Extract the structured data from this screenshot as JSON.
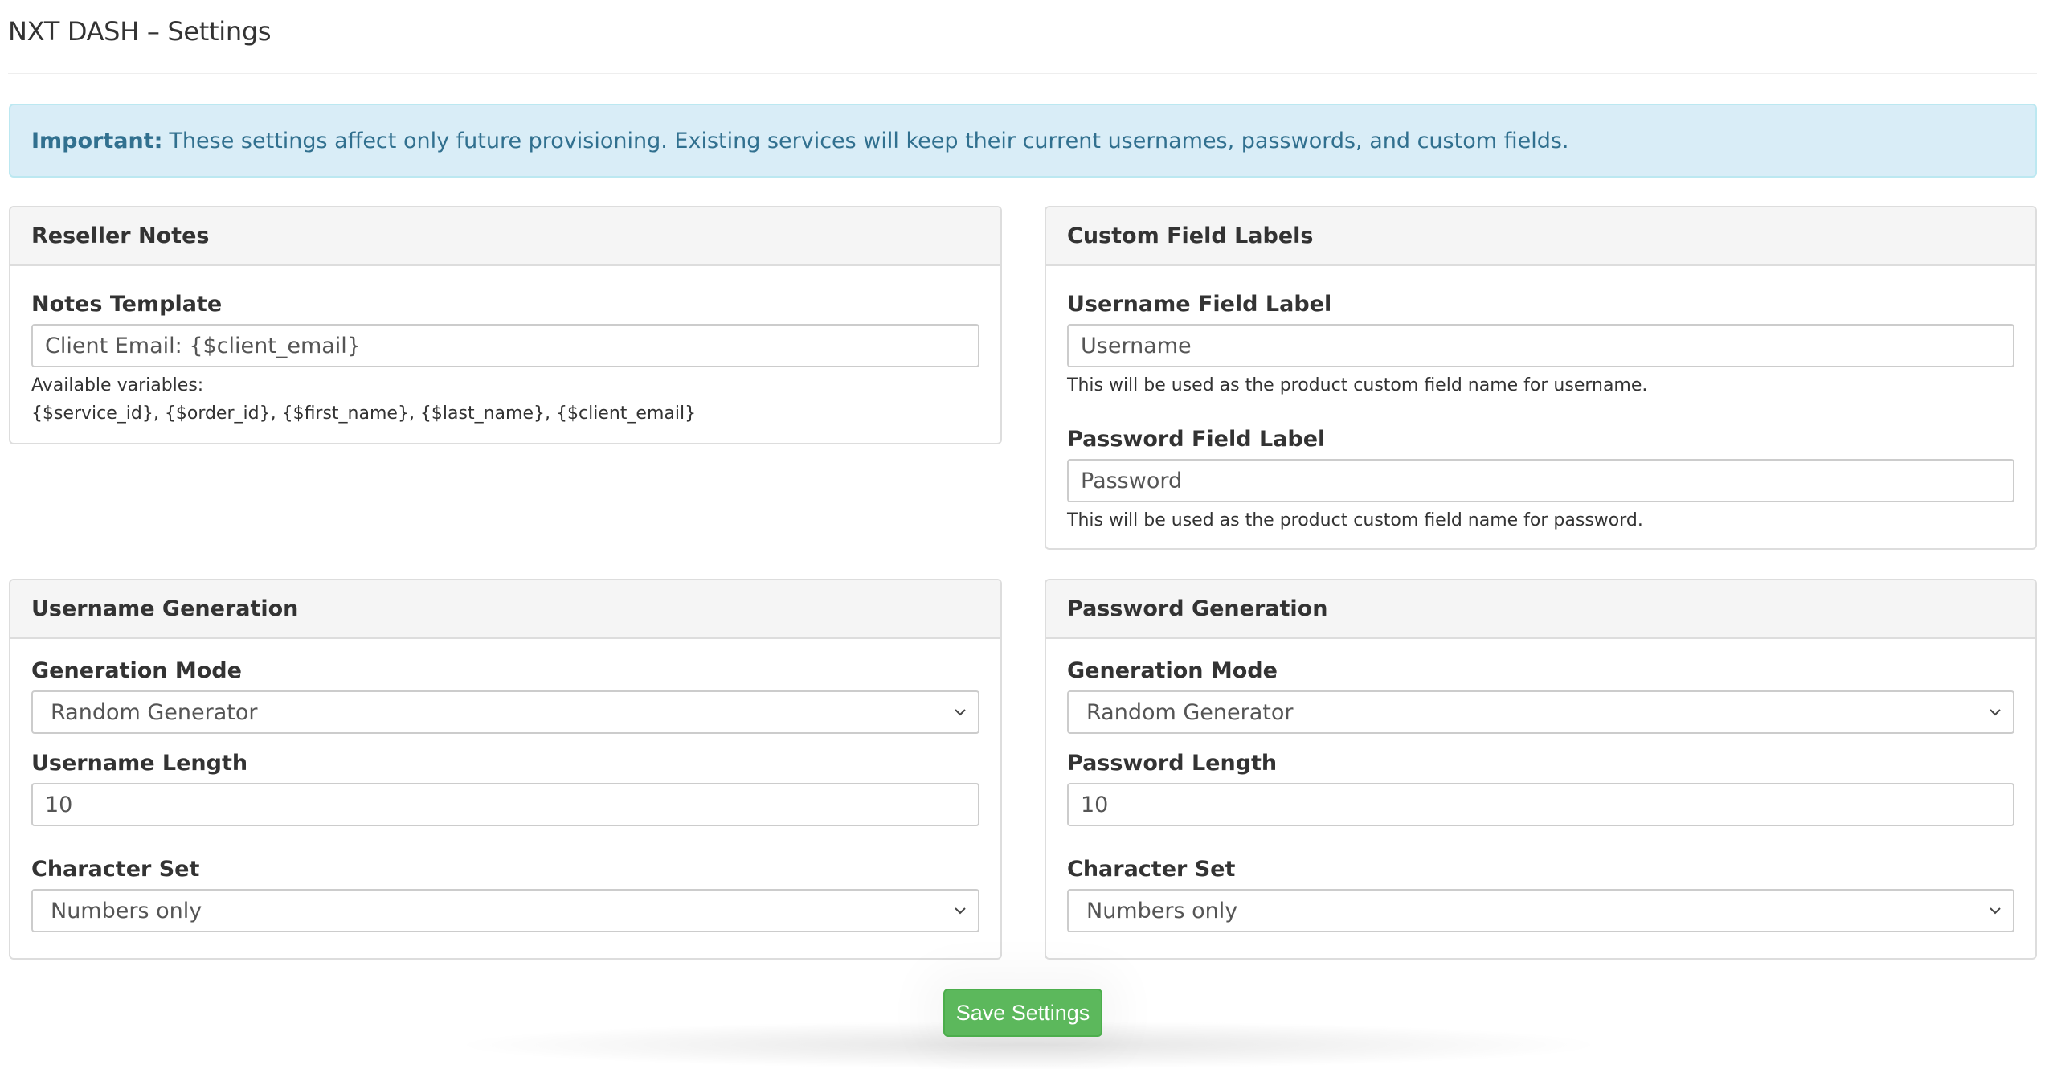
{
  "page": {
    "title": "NXT DASH – Settings"
  },
  "alert": {
    "strong": "Important:",
    "text": "These settings affect only future provisioning. Existing services will keep their current usernames, passwords, and custom fields."
  },
  "reseller_notes": {
    "heading": "Reseller Notes",
    "notes_label": "Notes Template",
    "notes_value": "Client Email: {$client_email}",
    "help_line1": "Available variables:",
    "help_line2": "{$service_id}, {$order_id}, {$first_name}, {$last_name}, {$client_email}"
  },
  "custom_field_labels": {
    "heading": "Custom Field Labels",
    "username_label": "Username Field Label",
    "username_value": "Username",
    "username_help": "This will be used as the product custom field name for username.",
    "password_label": "Password Field Label",
    "password_value": "Password",
    "password_help": "This will be used as the product custom field name for password."
  },
  "username_generation": {
    "heading": "Username Generation",
    "mode_label": "Generation Mode",
    "mode_value": "Random Generator",
    "length_label": "Username Length",
    "length_value": "10",
    "charset_label": "Character Set",
    "charset_value": "Numbers only"
  },
  "password_generation": {
    "heading": "Password Generation",
    "mode_label": "Generation Mode",
    "mode_value": "Random Generator",
    "length_label": "Password Length",
    "length_value": "10",
    "charset_label": "Character Set",
    "charset_value": "Numbers only"
  },
  "actions": {
    "save_label": "Save Settings"
  },
  "icons": {
    "select_arrow": "chevron-down-icon"
  },
  "colors": {
    "alert_bg": "#d9edf7",
    "alert_text": "#31708f",
    "save_button": "#5cb85c",
    "panel_heading_bg": "#f5f5f5"
  }
}
